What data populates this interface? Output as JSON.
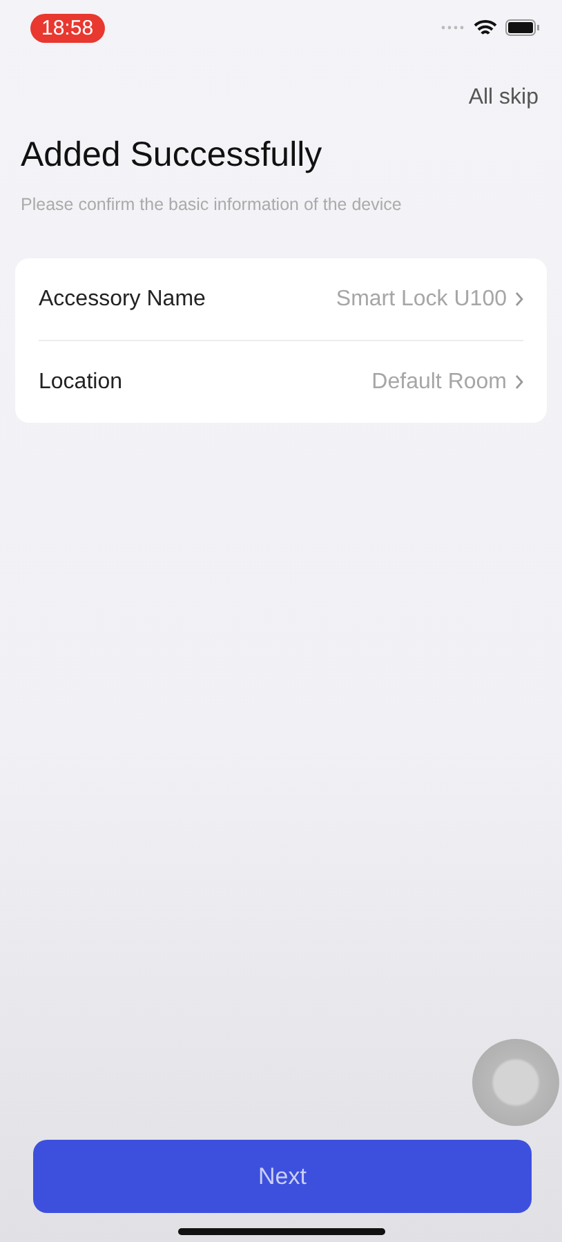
{
  "status_bar": {
    "time": "18:58"
  },
  "header": {
    "skip": "All skip"
  },
  "title": "Added Successfully",
  "subtitle": "Please confirm the basic information of the device",
  "fields": [
    {
      "label": "Accessory Name",
      "value": "Smart Lock U100"
    },
    {
      "label": "Location",
      "value": "Default Room"
    }
  ],
  "button": "Next"
}
